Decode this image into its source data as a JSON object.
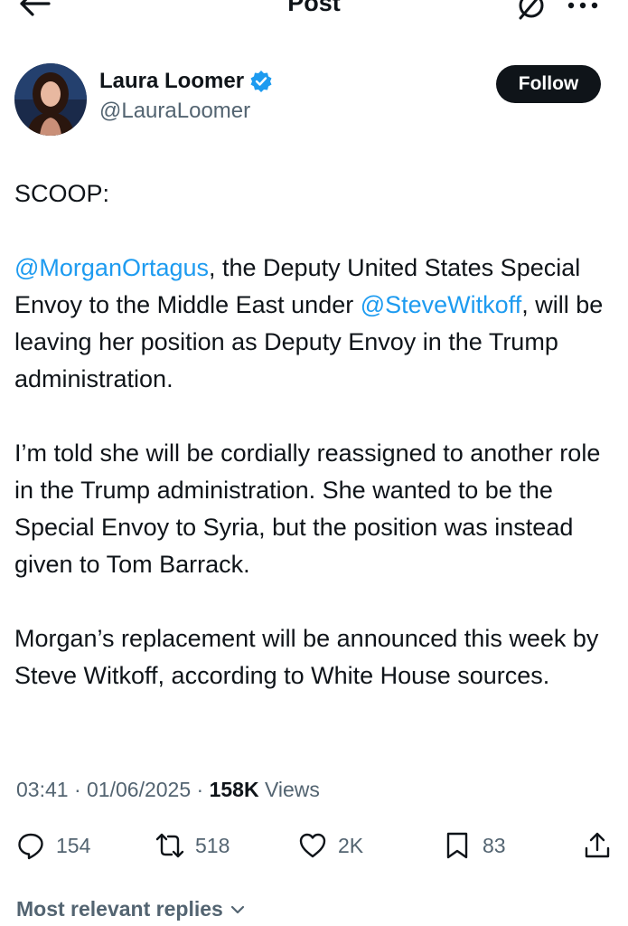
{
  "header": {
    "title": "Post",
    "back_icon": "arrow-left-icon",
    "grok_icon": "grok-icon",
    "more_icon": "more-horizontal-icon"
  },
  "author": {
    "name": "Laura Loomer",
    "handle": "@LauraLoomer",
    "verified_color": "#1d9bf0",
    "follow_label": "Follow"
  },
  "post": {
    "p1": "SCOOP:",
    "p2_mention1": "@MorganOrtagus",
    "p2_text1": ", the Deputy United States Special Envoy to the Middle East under ",
    "p2_mention2": "@SteveWitkoff",
    "p2_text2": ", will be leaving her position as Deputy Envoy in the Trump administration.",
    "p3": "I’m told she will be cordially reassigned to another role in the Trump administration. She wanted to be the Special Envoy to Syria, but the position was instead given to Tom Barrack.",
    "p4": "Morgan’s replacement will be announced this week by Steve Witkoff, according to White House sources."
  },
  "meta": {
    "time": "03:41",
    "date": "01/06/2025",
    "views_count": "158K",
    "views_label": "Views"
  },
  "actions": {
    "replies": "154",
    "reposts": "518",
    "likes": "2K",
    "bookmarks": "83"
  },
  "footer": {
    "replies_sort_label": "Most relevant replies"
  },
  "colors": {
    "accent": "#1d9bf0",
    "text": "#0f1419",
    "muted": "#536471"
  }
}
